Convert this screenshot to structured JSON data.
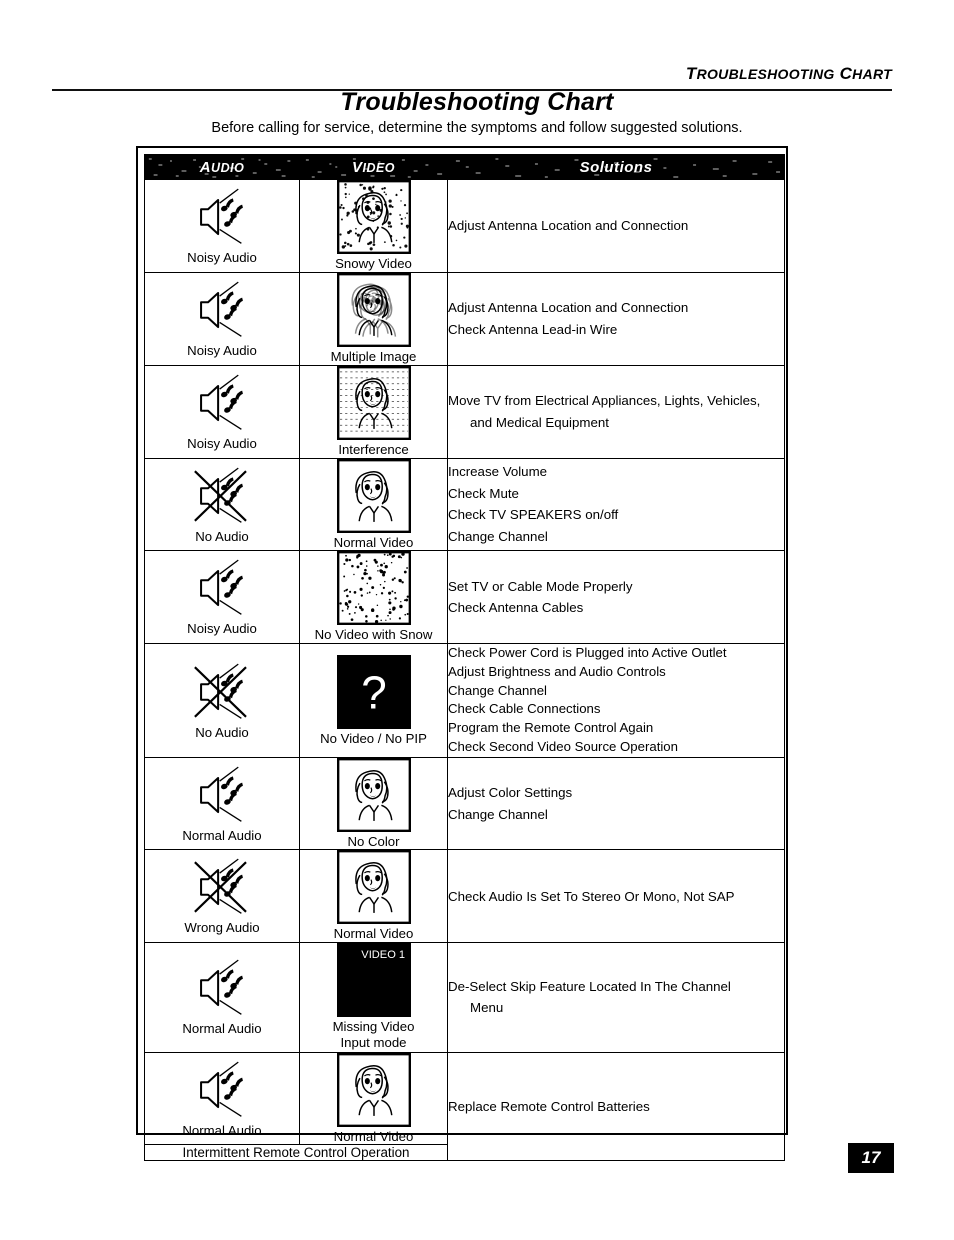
{
  "running_head": "TROUBLESHOOTING CHART",
  "title": "Troubleshooting Chart",
  "subtitle": "Before calling for service, determine the symptoms and follow suggested solutions.",
  "page_number": "17",
  "columns": {
    "audio": "AUDIO",
    "video": "VIDEO",
    "solutions": "Solutions"
  },
  "rows": [
    {
      "audio_icon": "speaker-noisy-icon",
      "audio_label": "Noisy Audio",
      "video_icon": "tv-snowy-face-icon",
      "video_label": "Snowy Video",
      "solutions": [
        "Adjust Antenna Location and Connection"
      ]
    },
    {
      "audio_icon": "speaker-noisy-icon",
      "audio_label": "Noisy Audio",
      "video_icon": "tv-multiple-image-icon",
      "video_label": "Multiple Image",
      "solutions": [
        "Adjust Antenna Location and Connection",
        "Check Antenna Lead-in Wire"
      ]
    },
    {
      "audio_icon": "speaker-noisy-icon",
      "audio_label": "Noisy Audio",
      "video_icon": "tv-interference-icon",
      "video_label": "Interference",
      "solutions": [
        "Move TV from Electrical Appliances, Lights, Vehicles,",
        "and Medical Equipment"
      ],
      "indent_second": true
    },
    {
      "audio_icon": "speaker-muted-icon",
      "audio_label": "No Audio",
      "video_icon": "tv-normal-face-icon",
      "video_label": "Normal Video",
      "solutions": [
        "Increase Volume",
        "Check Mute",
        "Check TV SPEAKERS on/off",
        "Change Channel"
      ]
    },
    {
      "audio_icon": "speaker-noisy-icon",
      "audio_label": "Noisy Audio",
      "video_icon": "tv-snow-only-icon",
      "video_label": "No Video with Snow",
      "solutions": [
        "Set TV or Cable Mode Properly",
        "Check Antenna Cables"
      ]
    },
    {
      "audio_icon": "speaker-muted-icon",
      "audio_label": "No Audio",
      "video_icon": "tv-question-mark-icon",
      "video_label": "No Video / No PIP",
      "solutions": [
        "Check Power Cord is Plugged into Active Outlet",
        "Adjust Brightness and Audio Controls",
        "Change Channel",
        "Check Cable Connections",
        "Program the Remote Control Again",
        "Check Second Video Source Operation"
      ],
      "tight": true
    },
    {
      "audio_icon": "speaker-noisy-icon",
      "audio_label": "Normal Audio",
      "video_icon": "tv-no-color-face-icon",
      "video_label": "No Color",
      "solutions": [
        "Adjust Color Settings",
        "Change Channel"
      ]
    },
    {
      "audio_icon": "speaker-muted-icon",
      "audio_label": "Wrong Audio",
      "video_icon": "tv-normal-face-icon",
      "video_label": "Normal Video",
      "solutions": [
        "Check Audio Is Set To Stereo Or Mono, Not SAP"
      ]
    },
    {
      "audio_icon": "speaker-noisy-icon",
      "audio_label": "Normal Audio",
      "video_icon": "tv-video1-black-icon",
      "video_screen_text": "VIDEO 1",
      "video_label": "Missing Video",
      "video_label2": "Input mode",
      "solutions": [
        "De-Select Skip Feature Located In The Channel",
        "Menu"
      ],
      "indent_second": true
    },
    {
      "audio_icon": "speaker-noisy-icon",
      "audio_label": "Normal Audio",
      "video_icon": "tv-normal-face-icon",
      "video_label": "Normal Video",
      "solutions": [
        "Replace Remote Control Batteries"
      ],
      "merged_note": "Intermittent Remote Control Operation"
    }
  ]
}
